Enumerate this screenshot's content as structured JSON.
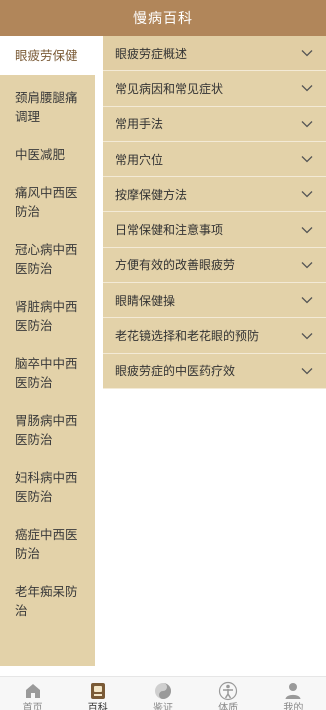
{
  "header": {
    "title": "慢病百科"
  },
  "sidebar": {
    "items": [
      {
        "label": "眼疲劳保健",
        "active": true
      },
      {
        "label": "颈肩腰腿痛调理"
      },
      {
        "label": "中医减肥"
      },
      {
        "label": "痛风中西医防治"
      },
      {
        "label": "冠心病中西医防治"
      },
      {
        "label": "肾脏病中西医防治"
      },
      {
        "label": "脑卒中中西医防治"
      },
      {
        "label": "胃肠病中西医防治"
      },
      {
        "label": "妇科病中西医防治"
      },
      {
        "label": "癌症中西医防治"
      },
      {
        "label": "老年痴呆防治"
      }
    ]
  },
  "menu": {
    "items": [
      {
        "label": "眼疲劳症概述"
      },
      {
        "label": "常见病因和常见症状"
      },
      {
        "label": "常用手法"
      },
      {
        "label": "常用穴位"
      },
      {
        "label": "按摩保健方法"
      },
      {
        "label": "日常保健和注意事项"
      },
      {
        "label": "方便有效的改善眼疲劳"
      },
      {
        "label": "眼睛保健操"
      },
      {
        "label": "老花镜选择和老花眼的预防"
      },
      {
        "label": "眼疲劳症的中医药疗效"
      }
    ]
  },
  "tabbar": {
    "items": [
      {
        "label": "首页",
        "icon": "home-icon"
      },
      {
        "label": "百科",
        "icon": "encyclopedia-icon",
        "active": true
      },
      {
        "label": "鉴证",
        "icon": "yin-yang-icon"
      },
      {
        "label": "体质",
        "icon": "body-icon"
      },
      {
        "label": "我的",
        "icon": "user-icon"
      }
    ]
  },
  "colors": {
    "header_bg": "#b1865a",
    "panel_bg": "#e3d2a9",
    "active_text": "#7a5a36"
  }
}
